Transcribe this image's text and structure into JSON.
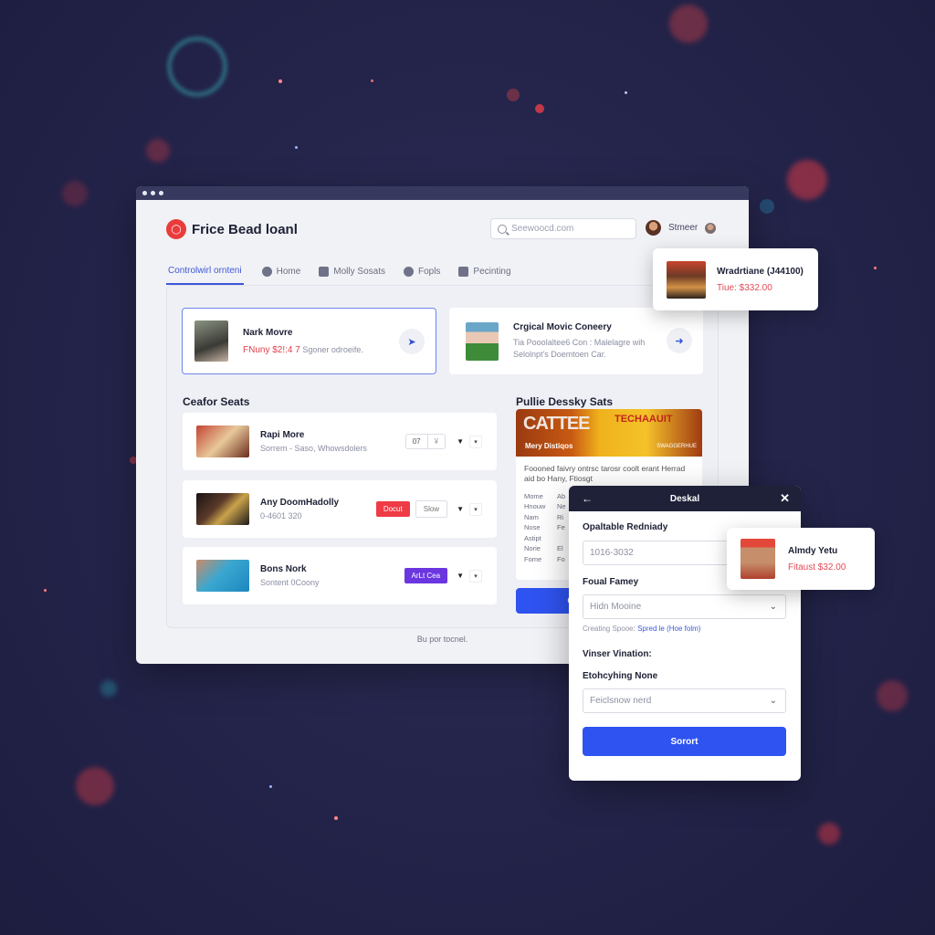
{
  "window": {
    "brand_name": "Frice Bead loanl",
    "search_placeholder": "Seewoocd.com",
    "user_name": "Stmeer",
    "footer": "Bu por tocnel."
  },
  "tabs": [
    {
      "label": "Controlwirl ornteni",
      "icon": "none",
      "active": true
    },
    {
      "label": "Home",
      "icon": "home-icon",
      "active": false
    },
    {
      "label": "Molly Sosats",
      "icon": "people-icon",
      "active": false
    },
    {
      "label": "Fopls",
      "icon": "info-icon",
      "active": false
    },
    {
      "label": "Pecinting",
      "icon": "clipboard-icon",
      "active": false
    }
  ],
  "featured": [
    {
      "title": "Nark Movre",
      "price": "FNuny $2!:4 7",
      "sub": "Sgoner odroeife.",
      "action_icon": "bird-icon",
      "selected": true
    },
    {
      "title": "Crgical Movic Coneery",
      "sub": "Tia Pooolaltee6 Con : Malelagre wih Selolnpt's Doemtoen Car.",
      "action_icon": "arrow-right-icon",
      "selected": false
    }
  ],
  "seats_section": {
    "title": "Ceafor Seats",
    "rows": [
      {
        "title": "Rapi More",
        "sub": "Sorrem - Saso, Whowsdolers",
        "qty": "07",
        "qty_unit": "¥",
        "button": null
      },
      {
        "title": "Any DoomHadolly",
        "sub": "0-4601 320",
        "button": "Docut",
        "button_color": "#ee3b46",
        "secondary": "Slow"
      },
      {
        "title": "Bons Nork",
        "sub": "Sontent 0Coony",
        "button": "ArLt Cea",
        "button_color": "#6b36e0"
      }
    ]
  },
  "promo": {
    "title": "Pullie Dessky Sats",
    "banner_big": "CATTEE",
    "banner_brand": "TECHAAUIT",
    "banner_small": "Mery Distiqos",
    "banner_tag": "SWAGGERHUE",
    "description": "Foooned faivry ontrsc tarosr coolt erant Herrad aid bo Hany, Ftiosgt",
    "specs": [
      [
        "Mome",
        "Ab"
      ],
      [
        "Hnouw",
        "Ne"
      ],
      [
        "Nam",
        "Ri"
      ],
      [
        "Nose",
        "Fe"
      ],
      [
        "Astipt",
        ""
      ],
      [
        "Norie",
        "El"
      ],
      [
        "Fome",
        "Fo"
      ]
    ],
    "button": "C"
  },
  "notifications": [
    {
      "title": "Wradrtiane (J44100)",
      "price": "Tiue: $332.00"
    },
    {
      "title": "Almdy Yetu",
      "price": "Fitaust $32.00"
    }
  ],
  "dialog": {
    "title": "Deskal",
    "field1_label": "Opaltable Redniady",
    "field1_value": "1016-3032",
    "field2_label": "Foual Famey",
    "field2_value": "Hidn Mooine",
    "hint_prefix": "Creating Spooe:",
    "hint_link": "Spred le (Hoe folm)",
    "section_label": "Vinser Vination:",
    "field3_label": "Etohcyhing None",
    "field3_value": "Feiclsnow nerd",
    "submit": "Sorort"
  },
  "colors": {
    "accent": "#2f53f0",
    "danger": "#ee3b46",
    "purple": "#6b36e0",
    "brand_red": "#ea3c3c",
    "dark_header": "#1f2138"
  }
}
